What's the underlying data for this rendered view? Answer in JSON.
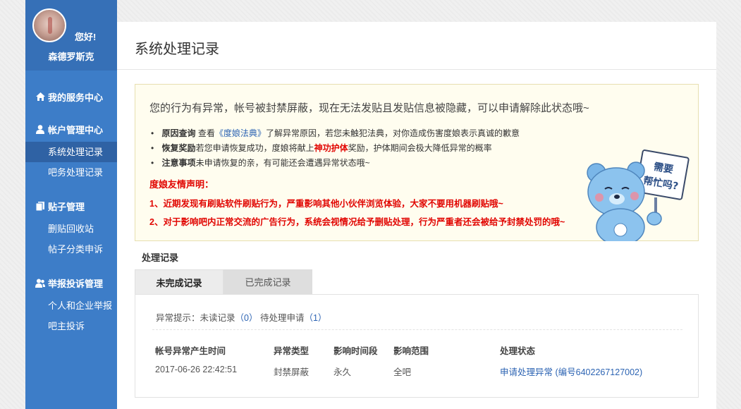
{
  "user": {
    "greeting": "您好!",
    "name": "森德罗斯克"
  },
  "sidebar": {
    "groups": [
      {
        "label": "我的服务中心",
        "icon": "home-icon",
        "items": []
      },
      {
        "label": "帐户管理中心",
        "icon": "user-icon",
        "items": [
          {
            "label": "系统处理记录",
            "active": true
          },
          {
            "label": "吧务处理记录"
          }
        ]
      },
      {
        "label": "贴子管理",
        "icon": "document-icon",
        "items": [
          {
            "label": "删贴回收站"
          },
          {
            "label": "帖子分类申诉"
          }
        ]
      },
      {
        "label": "举报投诉管理",
        "icon": "users-icon",
        "items": [
          {
            "label": "个人和企业举报"
          },
          {
            "label": "吧主投诉"
          }
        ]
      }
    ]
  },
  "page": {
    "title": "系统处理记录"
  },
  "notice": {
    "title": "您的行为有异常，帐号被封禁屏蔽，现在无法发贴且发贴信息被隐藏，可以申请解除此状态哦~",
    "bullets": [
      {
        "label": "原因查询",
        "pre": "查看",
        "link": "《度娘法典》",
        "post": "了解异常原因，若您未触犯法典，对你造成伤害度娘表示真诚的歉意"
      },
      {
        "label": "恢复奖励",
        "pre": "若您申请恢复成功，度娘将献上",
        "highlight": "神功护体",
        "post": "奖励，护体期间会极大降低异常的概率"
      },
      {
        "label": "注意事项",
        "pre": "未申请恢复的亲，有可能还会遭遇异常状态哦~"
      }
    ],
    "declaration_title": "度娘友情声明：",
    "declarations": [
      "1、近期发现有刷贴软件刷贴行为，严重影响其他小伙伴浏览体验，大家不要用机器刷贴哦~",
      "2、对于影响吧内正常交流的广告行为，系统会视情况给予删贴处理，行为严重者还会被给予封禁处罚的哦~"
    ],
    "mascot_sign": [
      "需要",
      "帮忙吗?"
    ]
  },
  "records": {
    "section_label": "处理记录",
    "tabs": [
      {
        "label": "未完成记录",
        "active": true
      },
      {
        "label": "已完成记录"
      }
    ],
    "hint": {
      "prefix": "异常提示：",
      "unread_label": "未读记录",
      "unread_count": "（0）",
      "pending_label": "待处理申请",
      "pending_count": "（1）"
    },
    "columns": [
      "帐号异常产生时间",
      "异常类型",
      "影响时间段",
      "影响范围",
      "处理状态"
    ],
    "rows": [
      {
        "time": "2017-06-26 22:42:51",
        "type": "封禁屏蔽",
        "duration": "永久",
        "scope": "全吧",
        "status": "申请处理异常 (编号6402267127002)"
      }
    ]
  },
  "colors": {
    "sidebar": "#3d7dc8",
    "sidebar_active": "#2f62a4",
    "link": "#2d64b3",
    "alert": "#e10602",
    "notice_bg": "#fffdef"
  }
}
